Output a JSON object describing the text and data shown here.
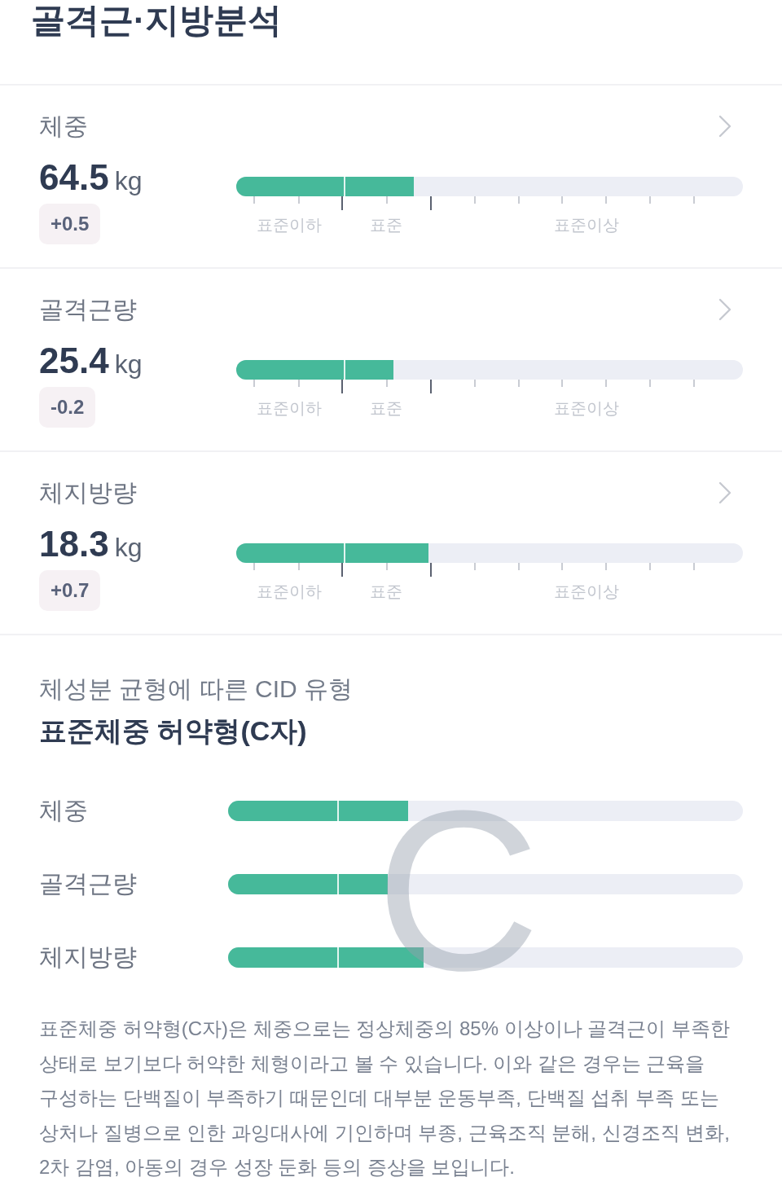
{
  "page": {
    "title": "골격근·지방분석"
  },
  "metrics": [
    {
      "label": "체중",
      "value": "64.5",
      "unit": "kg",
      "change": "+0.5",
      "level": 0.35,
      "scale_labels": [
        "표준이하",
        "표준",
        "표준이상"
      ]
    },
    {
      "label": "골격근량",
      "value": "25.4",
      "unit": "kg",
      "change": "-0.2",
      "level": 0.31,
      "scale_labels": [
        "표준이하",
        "표준",
        "표준이상"
      ]
    },
    {
      "label": "체지방량",
      "value": "18.3",
      "unit": "kg",
      "change": "+0.7",
      "level": 0.38,
      "scale_labels": [
        "표준이하",
        "표준",
        "표준이상"
      ]
    }
  ],
  "cid": {
    "caption": "체성분 균형에 따른 CID 유형",
    "type_name": "표준체중 허약형(C자)",
    "shape_letter": "C",
    "bars": [
      {
        "label": "체중",
        "level": 0.35
      },
      {
        "label": "골격근량",
        "level": 0.31
      },
      {
        "label": "체지방량",
        "level": 0.38
      }
    ],
    "description": "표준체중 허약형(C자)은 체중으로는 정상체중의 85% 이상이나 골격근이 부족한 상태로 보기보다 허약한 체형이라고 볼 수 있습니다. 이와 같은 경우는 근육을 구성하는 단백질이 부족하기 때문인데 대부분 운동부족, 단백질 섭취 부족 또는 상처나 질병으로 인한 과잉대사에 기인하며 부종, 근육조직 분해, 신경조직 변화, 2차 감염, 아동의 경우 성장 둔화 등의 증상을 보입니다."
  }
}
